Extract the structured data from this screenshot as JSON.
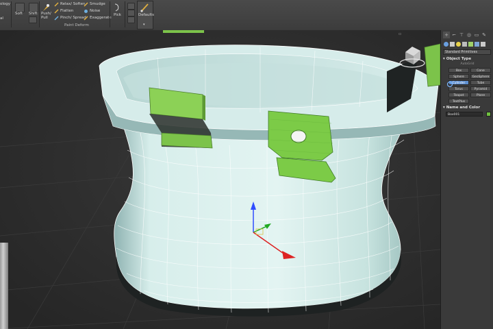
{
  "ribbon": {
    "left_clip_labels": [
      "ology",
      "al"
    ],
    "soft": "Soft",
    "shift": "Shift",
    "push_pull": "Push/\nPull",
    "relax_soften": "Relax/ Soften",
    "flatten": "Flatten",
    "pinch_spread": "Pinch/ Spread",
    "smudge": "Smudge",
    "noise": "Noise",
    "exaggerate": "Exaggerate",
    "group_label": "Paint Deform",
    "pick": "Pick",
    "defaults": "Defaults"
  },
  "command_panel": {
    "tab_icons": [
      "plus-icon",
      "pointer-curve-icon",
      "hierarchy-icon",
      "circle-icon",
      "display-icon",
      "wrench-icon"
    ],
    "category_icons": [
      "geometry-icon",
      "shapes-icon",
      "lights-icon",
      "cameras-icon",
      "helpers-icon",
      "spacewarps-icon",
      "systems-icon"
    ],
    "primitive_dropdown": "Standard Primitives",
    "object_type_header": "Object Type",
    "autogrid": "AutoGrid",
    "object_buttons": [
      {
        "label": "Box",
        "selected": false
      },
      {
        "label": "Cone",
        "selected": false
      },
      {
        "label": "Sphere",
        "selected": false
      },
      {
        "label": "GeoSphere",
        "selected": false
      },
      {
        "label": "Cylinder",
        "selected": true
      },
      {
        "label": "Tube",
        "selected": false
      },
      {
        "label": "Torus",
        "selected": false
      },
      {
        "label": "Pyramid",
        "selected": false
      },
      {
        "label": "Teapot",
        "selected": false
      },
      {
        "label": "Plane",
        "selected": false
      },
      {
        "label": "TextPlus",
        "selected": false
      }
    ],
    "name_color_header": "Name and Color",
    "object_name": "Box001",
    "object_color": "#70c040"
  },
  "colors": {
    "mesh": "#cfe9e6",
    "mesh_shadow": "#8fb3b2",
    "green_part": "#7cc34a",
    "selection_blue": "#5e8fd0"
  }
}
